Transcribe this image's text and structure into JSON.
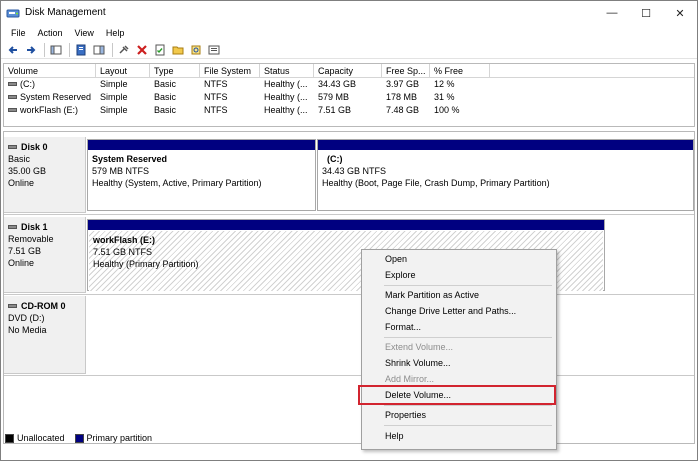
{
  "window": {
    "title": "Disk Management",
    "minimize": "—",
    "maximize": "☐",
    "close": "✕"
  },
  "menu": [
    "File",
    "Action",
    "View",
    "Help"
  ],
  "volume_list": {
    "columns": [
      "Volume",
      "Layout",
      "Type",
      "File System",
      "Status",
      "Capacity",
      "Free Sp...",
      "% Free"
    ],
    "rows": [
      [
        "(C:)",
        "Simple",
        "Basic",
        "NTFS",
        "Healthy (...",
        "34.43 GB",
        "3.97 GB",
        "12 %"
      ],
      [
        "System Reserved",
        "Simple",
        "Basic",
        "NTFS",
        "Healthy (...",
        "579 MB",
        "178 MB",
        "31 %"
      ],
      [
        "workFlash (E:)",
        "Simple",
        "Basic",
        "NTFS",
        "Healthy (...",
        "7.51 GB",
        "7.48 GB",
        "100 %"
      ]
    ]
  },
  "disks": [
    {
      "name": "Disk 0",
      "type": "Basic",
      "size": "35.00 GB",
      "status": "Online",
      "partitions": [
        {
          "name": "System Reserved",
          "fs": "579 MB NTFS",
          "health": "Healthy (System, Active, Primary Partition)"
        },
        {
          "name": "(C:)",
          "fs": "34.43 GB NTFS",
          "health": "Healthy (Boot, Page File, Crash Dump, Primary Partition)"
        }
      ]
    },
    {
      "name": "Disk 1",
      "type": "Removable",
      "size": "7.51 GB",
      "status": "Online",
      "partitions": [
        {
          "name": "workFlash  (E:)",
          "fs": "7.51 GB NTFS",
          "health": "Healthy (Primary Partition)"
        }
      ]
    },
    {
      "name": "CD-ROM 0",
      "type": "DVD (D:)",
      "size": "",
      "status": "No Media",
      "partitions": []
    }
  ],
  "legend": [
    {
      "label": "Unallocated",
      "color": "#000000"
    },
    {
      "label": "Primary partition",
      "color": "#000080"
    }
  ],
  "context_menu": {
    "items": [
      {
        "label": "Open",
        "enabled": true
      },
      {
        "label": "Explore",
        "enabled": true
      },
      {
        "label": "Mark Partition as Active",
        "enabled": true
      },
      {
        "label": "Change Drive Letter and Paths...",
        "enabled": true
      },
      {
        "label": "Format...",
        "enabled": true
      },
      {
        "label": "Extend Volume...",
        "enabled": false
      },
      {
        "label": "Shrink Volume...",
        "enabled": true
      },
      {
        "label": "Add Mirror...",
        "enabled": false
      },
      {
        "label": "Delete Volume...",
        "enabled": true,
        "highlighted": true
      },
      {
        "label": "Properties",
        "enabled": true
      },
      {
        "label": "Help",
        "enabled": true
      }
    ]
  },
  "colors": {
    "primary_partition": "#000080",
    "highlight_box": "#d2242f"
  }
}
